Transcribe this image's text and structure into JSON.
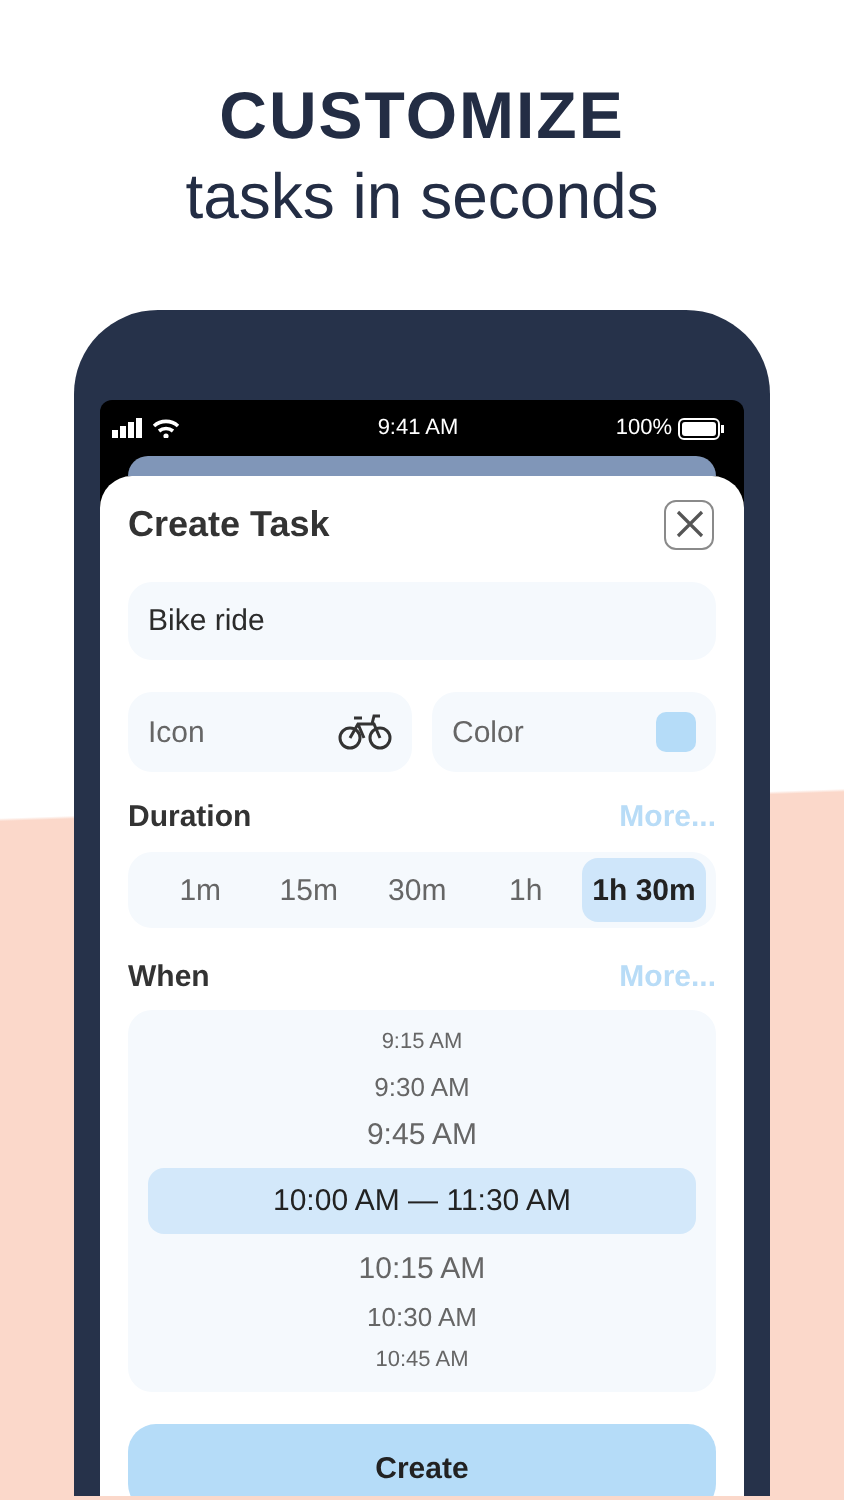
{
  "headline": {
    "title": "CUSTOMIZE",
    "subtitle": "tasks in seconds"
  },
  "status_bar": {
    "time": "9:41 AM",
    "battery": "100%"
  },
  "sheet": {
    "title": "Create Task",
    "name_field": {
      "value": "Bike ride"
    },
    "icon_field": {
      "label": "Icon"
    },
    "color_field": {
      "label": "Color",
      "color": "#b5dcf8"
    },
    "duration": {
      "label": "Duration",
      "more": "More...",
      "options": [
        {
          "label": "1m",
          "selected": false
        },
        {
          "label": "15m",
          "selected": false
        },
        {
          "label": "30m",
          "selected": false
        },
        {
          "label": "1h",
          "selected": false
        },
        {
          "label": "1h 30m",
          "selected": true
        }
      ]
    },
    "when": {
      "label": "When",
      "more": "More...",
      "times": [
        {
          "label": "9:15 AM",
          "selected": false
        },
        {
          "label": "9:30 AM",
          "selected": false
        },
        {
          "label": "9:45 AM",
          "selected": false
        },
        {
          "label": "10:00 AM — 11:30 AM",
          "selected": true
        },
        {
          "label": "10:15 AM",
          "selected": false
        },
        {
          "label": "10:30 AM",
          "selected": false
        },
        {
          "label": "10:45 AM",
          "selected": false
        }
      ]
    },
    "create_button": "Create"
  }
}
